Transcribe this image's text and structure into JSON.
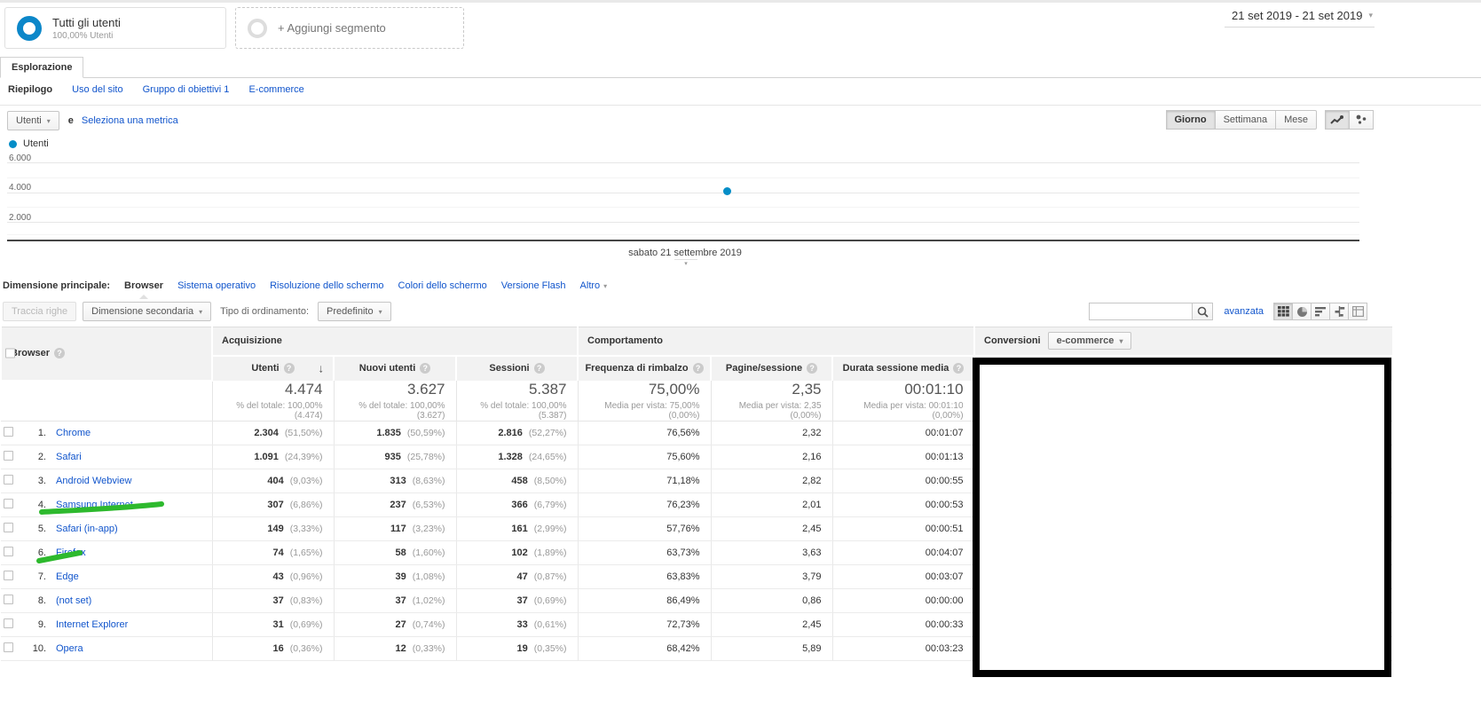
{
  "icons": {
    "caret_down": "▾",
    "sort_desc": "↓",
    "help": "?"
  },
  "header": {
    "segment": {
      "title": "Tutti gli utenti",
      "subtitle": "100,00% Utenti",
      "ring_color": "#0c87c9"
    },
    "add_segment_label": "+ Aggiungi segmento",
    "date_range": "21 set 2019 - 21 set 2019"
  },
  "tabs": {
    "explorer": "Esplorazione"
  },
  "report_nav": [
    {
      "label": "Riepilogo",
      "active": true
    },
    {
      "label": "Uso del sito"
    },
    {
      "label": "Gruppo di obiettivi 1"
    },
    {
      "label": "E-commerce"
    }
  ],
  "metric_picker": {
    "selected": "Utenti",
    "conjunction": "e",
    "add_metric_label": "Seleziona una metrica"
  },
  "granularity": [
    {
      "label": "Giorno",
      "active": true
    },
    {
      "label": "Settimana"
    },
    {
      "label": "Mese"
    }
  ],
  "chart_data": {
    "type": "line",
    "x": [
      "sabato 21 settembre 2019"
    ],
    "series": [
      {
        "name": "Utenti",
        "color": "#058dc7",
        "values": [
          4474
        ]
      }
    ],
    "title": "",
    "xlabel": "sabato 21 settembre 2019",
    "ylabel": "",
    "ylim": [
      0,
      7000
    ],
    "y_ticks": [
      2000,
      4000,
      6000
    ],
    "y_tick_labels_desc": [
      "6.000",
      "4.000",
      "2.000"
    ],
    "legend": "Utenti",
    "legend_position": "top-left",
    "grid": true
  },
  "dimension_bar": {
    "label": "Dimensione principale:",
    "selected": "Browser",
    "links": [
      {
        "label": "Sistema operativo"
      },
      {
        "label": "Risoluzione dello schermo"
      },
      {
        "label": "Colori dello schermo"
      },
      {
        "label": "Versione Flash"
      }
    ],
    "more_label": "Altro"
  },
  "table_controls": {
    "plot_rows_label": "Traccia righe",
    "secondary_dimension_label": "Dimensione secondaria",
    "sort_type_label": "Tipo di ordinamento:",
    "sort_selected": "Predefinito",
    "search_placeholder": "",
    "advanced_label": "avanzata"
  },
  "table": {
    "dimension_header": "Browser",
    "groups": {
      "acquisition": "Acquisizione",
      "behavior": "Comportamento",
      "conversions": "Conversioni",
      "conversions_selector": "e-commerce"
    },
    "columns": [
      {
        "label": "Utenti",
        "sorted": true
      },
      {
        "label": "Nuovi utenti"
      },
      {
        "label": "Sessioni"
      },
      {
        "label": "Frequenza di rimbalzo"
      },
      {
        "label": "Pagine/sessione"
      },
      {
        "label": "Durata sessione media"
      }
    ],
    "totals": {
      "users": "4.474",
      "users_note": "% del totale: 100,00% (4.474)",
      "new_users": "3.627",
      "new_users_note": "% del totale: 100,00% (3.627)",
      "sessions": "5.387",
      "sessions_note": "% del totale: 100,00% (5.387)",
      "bounce": "75,00%",
      "bounce_note": "Media per vista: 75,00% (0,00%)",
      "pages": "2,35",
      "pages_note": "Media per vista: 2,35 (0,00%)",
      "duration": "00:01:10",
      "duration_note": "Media per vista: 00:01:10 (0,00%)"
    },
    "rows": [
      {
        "rank": "1.",
        "name": "Chrome",
        "users": "2.304",
        "users_pct": "(51,50%)",
        "new_users": "1.835",
        "new_users_pct": "(50,59%)",
        "sessions": "2.816",
        "sessions_pct": "(52,27%)",
        "bounce": "76,56%",
        "pages": "2,32",
        "duration": "00:01:07"
      },
      {
        "rank": "2.",
        "name": "Safari",
        "users": "1.091",
        "users_pct": "(24,39%)",
        "new_users": "935",
        "new_users_pct": "(25,78%)",
        "sessions": "1.328",
        "sessions_pct": "(24,65%)",
        "bounce": "75,60%",
        "pages": "2,16",
        "duration": "00:01:13"
      },
      {
        "rank": "3.",
        "name": "Android Webview",
        "users": "404",
        "users_pct": "(9,03%)",
        "new_users": "313",
        "new_users_pct": "(8,63%)",
        "sessions": "458",
        "sessions_pct": "(8,50%)",
        "bounce": "71,18%",
        "pages": "2,82",
        "duration": "00:00:55"
      },
      {
        "rank": "4.",
        "name": "Samsung Internet",
        "users": "307",
        "users_pct": "(6,86%)",
        "new_users": "237",
        "new_users_pct": "(6,53%)",
        "sessions": "366",
        "sessions_pct": "(6,79%)",
        "bounce": "76,23%",
        "pages": "2,01",
        "duration": "00:00:53"
      },
      {
        "rank": "5.",
        "name": "Safari (in-app)",
        "users": "149",
        "users_pct": "(3,33%)",
        "new_users": "117",
        "new_users_pct": "(3,23%)",
        "sessions": "161",
        "sessions_pct": "(2,99%)",
        "bounce": "57,76%",
        "pages": "2,45",
        "duration": "00:00:51"
      },
      {
        "rank": "6.",
        "name": "Firefox",
        "users": "74",
        "users_pct": "(1,65%)",
        "new_users": "58",
        "new_users_pct": "(1,60%)",
        "sessions": "102",
        "sessions_pct": "(1,89%)",
        "bounce": "63,73%",
        "pages": "3,63",
        "duration": "00:04:07"
      },
      {
        "rank": "7.",
        "name": "Edge",
        "users": "43",
        "users_pct": "(0,96%)",
        "new_users": "39",
        "new_users_pct": "(1,08%)",
        "sessions": "47",
        "sessions_pct": "(0,87%)",
        "bounce": "63,83%",
        "pages": "3,79",
        "duration": "00:03:07"
      },
      {
        "rank": "8.",
        "name": "(not set)",
        "users": "37",
        "users_pct": "(0,83%)",
        "new_users": "37",
        "new_users_pct": "(1,02%)",
        "sessions": "37",
        "sessions_pct": "(0,69%)",
        "bounce": "86,49%",
        "pages": "0,86",
        "duration": "00:00:00"
      },
      {
        "rank": "9.",
        "name": "Internet Explorer",
        "users": "31",
        "users_pct": "(0,69%)",
        "new_users": "27",
        "new_users_pct": "(0,74%)",
        "sessions": "33",
        "sessions_pct": "(0,61%)",
        "bounce": "72,73%",
        "pages": "2,45",
        "duration": "00:00:33"
      },
      {
        "rank": "10.",
        "name": "Opera",
        "users": "16",
        "users_pct": "(0,36%)",
        "new_users": "12",
        "new_users_pct": "(0,33%)",
        "sessions": "19",
        "sessions_pct": "(0,35%)",
        "bounce": "68,42%",
        "pages": "5,89",
        "duration": "00:03:23"
      }
    ]
  },
  "annotations": {
    "highlight_color": "#2db92d"
  }
}
